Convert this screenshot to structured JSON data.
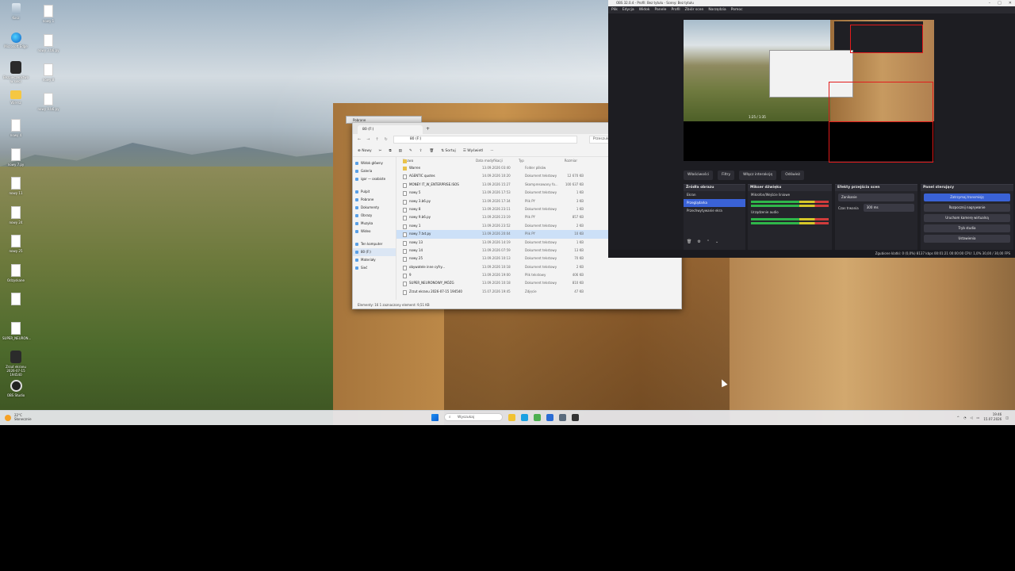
{
  "desktop": {
    "icons_left": [
      {
        "label": "Kosz",
        "icon": "recycle-bin-icon",
        "type": "bin"
      },
      {
        "label": "Microsoft Edge",
        "icon": "edge-icon",
        "type": "edge"
      },
      {
        "label": "Bezpieczeństwo w sieci",
        "icon": "app-icon",
        "type": "app"
      },
      {
        "label": "Wiersz",
        "icon": "folder-icon",
        "type": "folder"
      },
      {
        "label": "nowy 4",
        "icon": "file-icon",
        "type": "file"
      },
      {
        "label": "nowy 7.py",
        "icon": "file-icon",
        "type": "file"
      },
      {
        "label": "nowy 11",
        "icon": "file-icon",
        "type": "file"
      },
      {
        "label": "nowy 24",
        "icon": "file-icon",
        "type": "file"
      },
      {
        "label": "nowy 25",
        "icon": "file-icon",
        "type": "file"
      },
      {
        "label": "Odzyskane",
        "icon": "file-icon",
        "type": "file"
      },
      {
        "label": "",
        "icon": "file-icon",
        "type": "file"
      },
      {
        "label": "SUPER_NEURON...",
        "icon": "file-icon",
        "type": "file"
      },
      {
        "label": "Zrzut ekranu 2026-07-15 194540",
        "icon": "screenshot-icon",
        "type": "app"
      },
      {
        "label": "OBS Studio",
        "icon": "obs-icon",
        "type": "obs"
      }
    ],
    "icons_second": [
      {
        "label": "nowy 1",
        "icon": "file-icon"
      },
      {
        "label": "nowy 3.b6.py",
        "icon": "file-icon"
      },
      {
        "label": "nowy 8",
        "icon": "file-icon"
      },
      {
        "label": "nowy 9.b6.py",
        "icon": "file-icon"
      }
    ]
  },
  "explorer": {
    "back_tab": "Pobrane",
    "tab_title": "80 (F:)",
    "address": "80 (F:)",
    "search_placeholder": "Przeszukaj: 80 (F:)",
    "toolbar": {
      "new": "Nowy",
      "sort": "Sortuj",
      "view": "Wyświetl",
      "more": "···",
      "details": "Szczegóły"
    },
    "nav": [
      {
        "label": "Widok główny",
        "sel": false
      },
      {
        "label": "Galeria",
        "sel": false
      },
      {
        "label": "igor — osobiste",
        "sel": false
      },
      {
        "label": "",
        "sel": false,
        "gap": true
      },
      {
        "label": "Pulpit",
        "sel": false
      },
      {
        "label": "Pobrane",
        "sel": false
      },
      {
        "label": "Dokumenty",
        "sel": false
      },
      {
        "label": "Obrazy",
        "sel": false
      },
      {
        "label": "Muzyka",
        "sel": false
      },
      {
        "label": "Wideo",
        "sel": false
      },
      {
        "label": "",
        "sel": false,
        "gap": true
      },
      {
        "label": "Ten komputer",
        "sel": false
      },
      {
        "label": "80 (F:)",
        "sel": true
      },
      {
        "label": "Materiały",
        "sel": false
      },
      {
        "label": "Sieć",
        "sel": false
      }
    ],
    "columns": {
      "name": "Nazwa",
      "date": "Data modyfikacji",
      "type": "Typ",
      "size": "Rozmiar"
    },
    "rows": [
      {
        "name": "Warren",
        "date": "13.09.2026 03:40",
        "type": "Folder plików",
        "size": "",
        "kind": "folder"
      },
      {
        "name": "AGENTIC quotes",
        "date": "14.09.2026 10:20",
        "type": "Dokument tekstowy",
        "size": "12 670 KB",
        "kind": "file"
      },
      {
        "name": "MONEY IT_W_ENTERPRISE.ISOS",
        "date": "13.09.2026 15:27",
        "type": "Skompresowany fo...",
        "size": "100 637 KB",
        "kind": "file"
      },
      {
        "name": "nowy 5",
        "date": "13.09.2026 17:53",
        "type": "Dokument tekstowy",
        "size": "1 KB",
        "kind": "file"
      },
      {
        "name": "nowy 3.b6.py",
        "date": "13.09.2026 17:34",
        "type": "Plik PY",
        "size": "3 KB",
        "kind": "file"
      },
      {
        "name": "nowy 8",
        "date": "13.09.2026 23:11",
        "type": "Dokument tekstowy",
        "size": "1 KB",
        "kind": "file"
      },
      {
        "name": "nowy 9.b6.py",
        "date": "13.09.2026 23:19",
        "type": "Plik PY",
        "size": "857 KB",
        "kind": "file"
      },
      {
        "name": "nowy 1",
        "date": "13.09.2026 23:52",
        "type": "Dokument tekstowy",
        "size": "2 KB",
        "kind": "file"
      },
      {
        "name": "nowy 7.txt.py",
        "date": "13.09.2026 20:04",
        "type": "Plik PY",
        "size": "10 KB",
        "kind": "file",
        "sel": true
      },
      {
        "name": "nowy 13",
        "date": "13.09.2026 14:19",
        "type": "Dokument tekstowy",
        "size": "1 KB",
        "kind": "file"
      },
      {
        "name": "nowy 14",
        "date": "13.09.2026 07:59",
        "type": "Dokument tekstowy",
        "size": "13 KB",
        "kind": "file"
      },
      {
        "name": "nowy 25",
        "date": "13.09.2026 10:13",
        "type": "Dokument tekstowy",
        "size": "70 KB",
        "kind": "file"
      },
      {
        "name": "obywatele inne cyfry...",
        "date": "13.09.2026 10:18",
        "type": "Dokument tekstowy",
        "size": "2 KB",
        "kind": "file"
      },
      {
        "name": "9",
        "date": "13.09.2026 19:00",
        "type": "Plik tekstowy",
        "size": "406 KB",
        "kind": "file"
      },
      {
        "name": "SUPER_NEURONOWY_MÓZG",
        "date": "13.09.2026 10:18",
        "type": "Dokument tekstowy",
        "size": "810 KB",
        "kind": "file"
      },
      {
        "name": "Zrzut ekranu 2026-07-15 194540",
        "date": "15.07.2026 19:45",
        "type": "Zdjęcie",
        "size": "47 KB",
        "kind": "file"
      }
    ],
    "status": "Elementy: 16   1 zaznaczony element: 9,51 KB"
  },
  "obs": {
    "title": "OBS 32.0.4 - Profil: Bez tytułu - Sceny: Bez tytułu",
    "menu": [
      "Plik",
      "Edycja",
      "Widok",
      "Panele",
      "Profil",
      "Zbiór scen",
      "Narzędzia",
      "Pomoc"
    ],
    "dock_tabs": [
      "Właściwości",
      "Filtry",
      "Włącz interakcję",
      "Odśwież"
    ],
    "sources_title": "Źródła obrazu",
    "sources": [
      {
        "label": "Ekran",
        "sel": false
      },
      {
        "label": "Przeglądarka",
        "sel": true
      },
      {
        "label": "Przechwytywanie ekra",
        "sel": false
      }
    ],
    "mixer_title": "Mikser dźwięku",
    "mixer": [
      "Mikrofon/Wejście liniowe",
      "Urządzenie audio"
    ],
    "transitions_title": "Efekty przejścia scen",
    "transition_value": "Zanikanie",
    "duration_label": "Czas trwania",
    "duration_value": "300 ms",
    "controls_title": "Panel sterujący",
    "controls": [
      {
        "label": "Zatrzymaj transmisję",
        "primary": true
      },
      {
        "label": "Rozpocznij nagrywanie",
        "primary": false
      },
      {
        "label": "Uruchom kamerę wirtualną",
        "primary": false
      },
      {
        "label": "Tryb studia",
        "primary": false
      },
      {
        "label": "Ustawienia",
        "primary": false
      }
    ],
    "status": "Zgubione klatki: 0 (0,0%)   8137 kbps   00:01:21   00:00:00   CPU: 1,0%   30,00 / 30,00 FPS",
    "preview_label": "1:25 / 1:35"
  },
  "taskbar": {
    "weather_temp": "22°C",
    "weather_desc": "Słonecznie",
    "search_placeholder": "Wyszukaj",
    "apps": [
      "file-explorer-icon",
      "edge-icon",
      "chrome-icon",
      "store-icon",
      "settings-icon",
      "obs-icon"
    ],
    "time": "19:46",
    "date": "15.07.2026"
  }
}
